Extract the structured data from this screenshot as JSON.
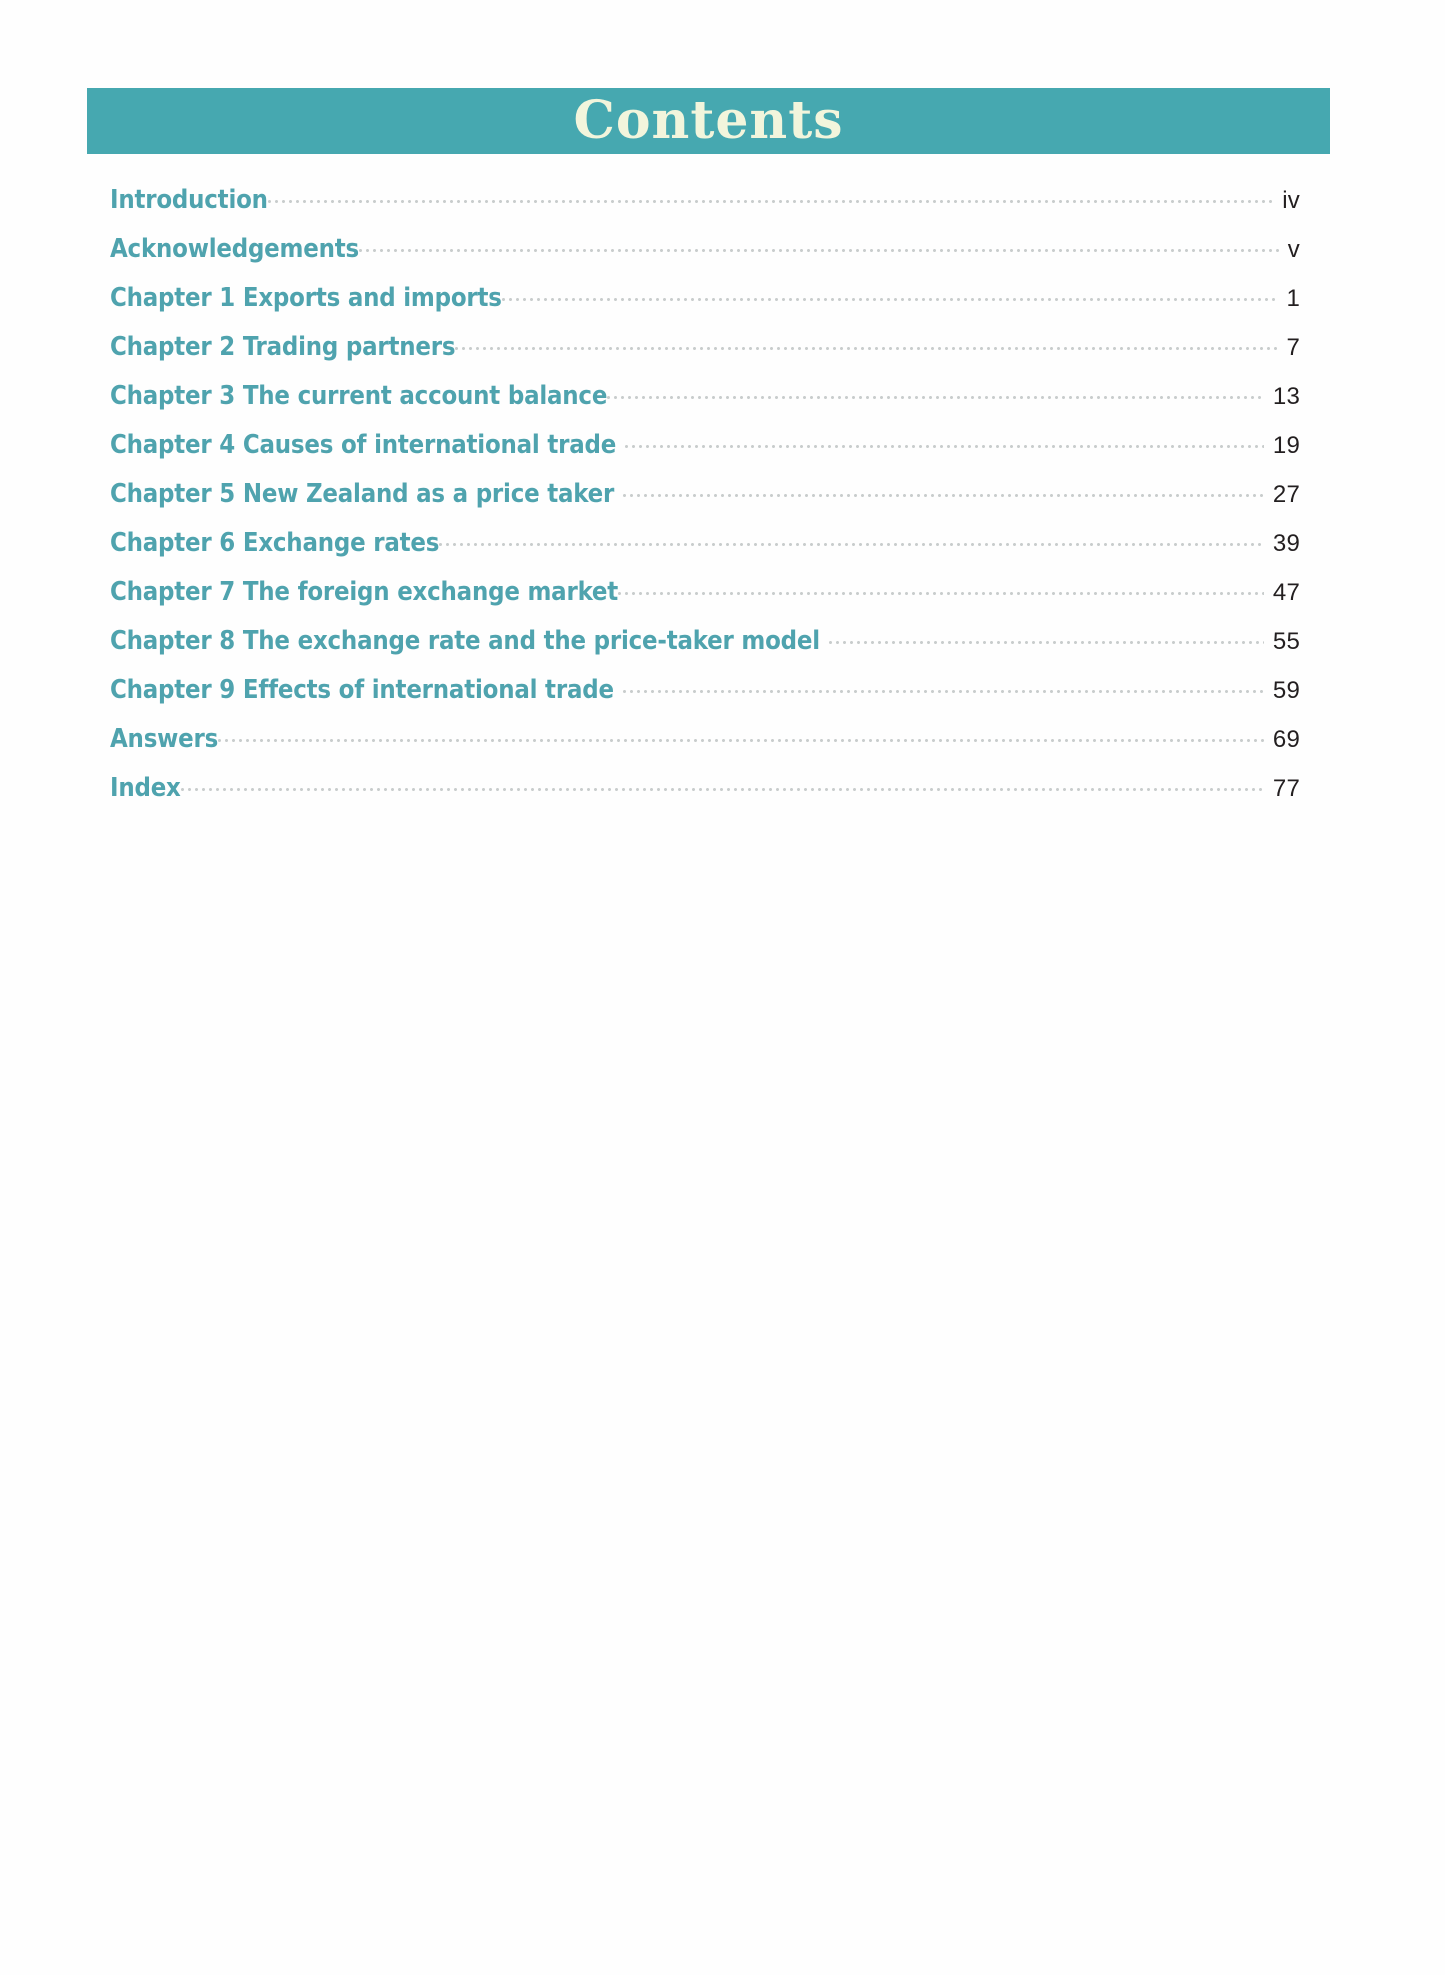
{
  "page": {
    "background_color": "#fefefe",
    "band_color": "#46a8b0",
    "heading_text_color": "#f2f5dc",
    "entry_color": "#4fa3ae",
    "page_number_color": "#231f20",
    "leader_dot_color": "#c9cdcd"
  },
  "header": {
    "title": "Contents"
  },
  "toc": {
    "entries": [
      {
        "label": "Introduction",
        "page": "iv"
      },
      {
        "label": "Acknowledgements",
        "page": "v"
      },
      {
        "label": "Chapter 1 Exports and imports",
        "page": "1"
      },
      {
        "label": "Chapter 2 Trading partners",
        "page": "7"
      },
      {
        "label": "Chapter 3 The current account balance",
        "page": "13"
      },
      {
        "label": "Chapter 4 Causes of international trade",
        "page": "19"
      },
      {
        "label": "Chapter 5 New Zealand as a price taker",
        "page": "27"
      },
      {
        "label": "Chapter 6 Exchange rates",
        "page": "39"
      },
      {
        "label": "Chapter 7 The foreign exchange market",
        "page": "47"
      },
      {
        "label": "Chapter 8 The exchange rate and the price-taker model",
        "page": "55"
      },
      {
        "label": "Chapter 9 Effects of international trade",
        "page": "59"
      },
      {
        "label": "Answers",
        "page": "69"
      },
      {
        "label": "Index",
        "page": "77"
      }
    ]
  }
}
